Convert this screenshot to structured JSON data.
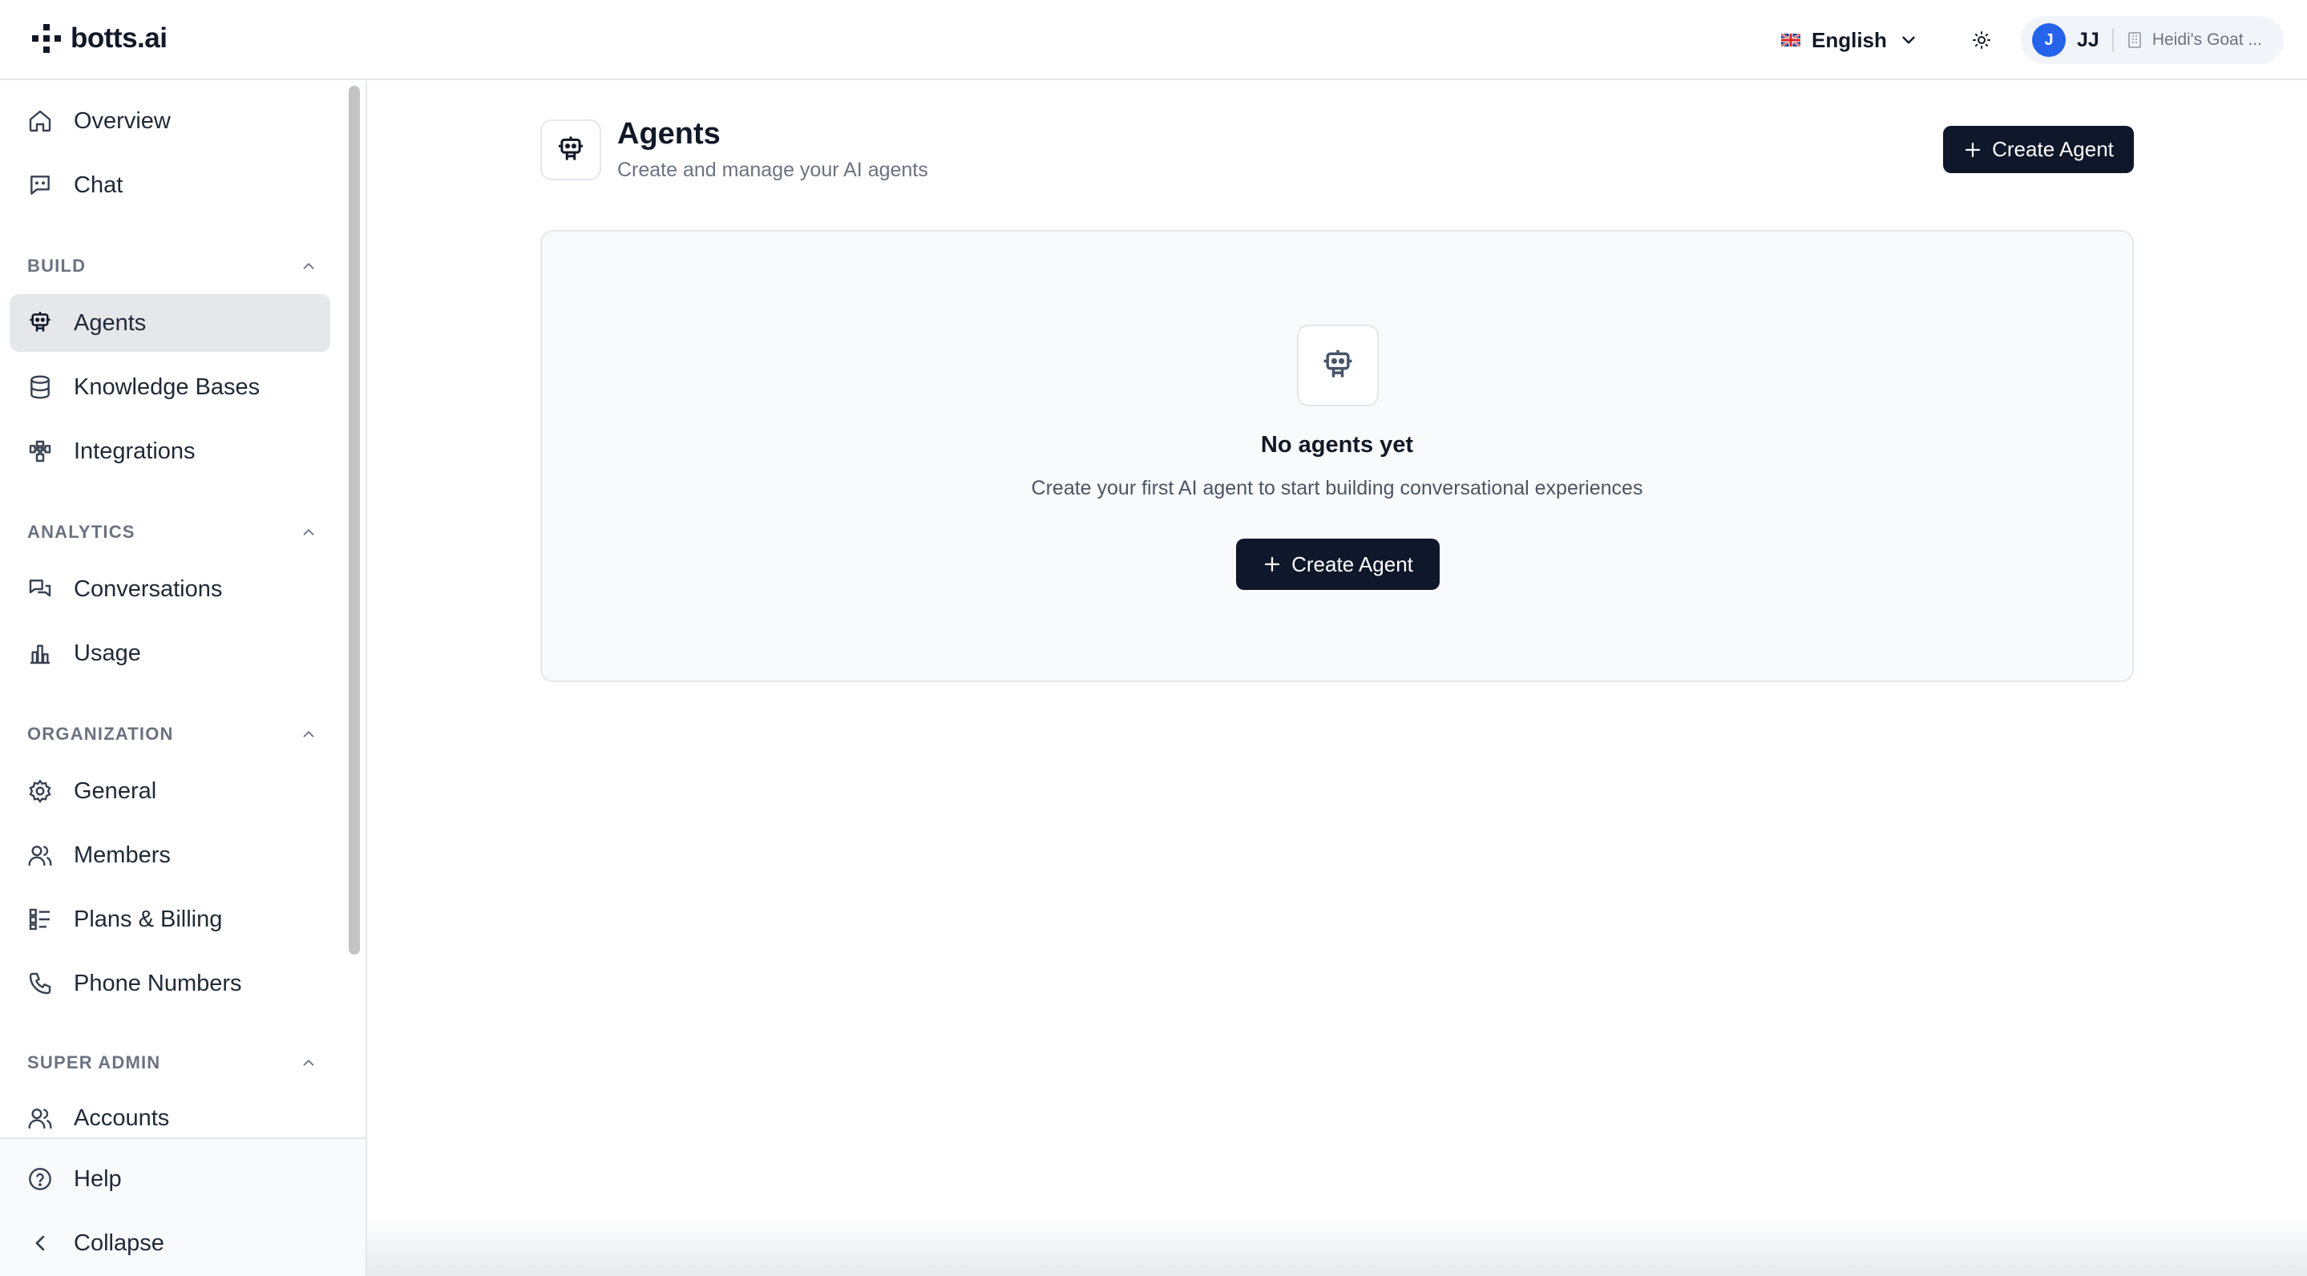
{
  "app": {
    "brand": "botts.ai"
  },
  "topbar": {
    "language": "English",
    "user_avatar": "J",
    "user_initials": "JJ",
    "organization": "Heidi's Goat ..."
  },
  "sidebar": {
    "top_items": [
      {
        "label": "Overview",
        "icon": "home-icon"
      },
      {
        "label": "Chat",
        "icon": "chat-icon"
      }
    ],
    "sections": [
      {
        "title": "BUILD",
        "items": [
          {
            "label": "Agents",
            "icon": "robot-icon",
            "active": true
          },
          {
            "label": "Knowledge Bases",
            "icon": "database-icon"
          },
          {
            "label": "Integrations",
            "icon": "puzzle-icon"
          }
        ]
      },
      {
        "title": "ANALYTICS",
        "items": [
          {
            "label": "Conversations",
            "icon": "conversations-icon"
          },
          {
            "label": "Usage",
            "icon": "bar-chart-icon"
          }
        ]
      },
      {
        "title": "ORGANIZATION",
        "items": [
          {
            "label": "General",
            "icon": "gear-icon"
          },
          {
            "label": "Members",
            "icon": "users-icon"
          },
          {
            "label": "Plans & Billing",
            "icon": "list-icon"
          },
          {
            "label": "Phone Numbers",
            "icon": "phone-icon"
          }
        ]
      },
      {
        "title": "SUPER ADMIN",
        "items": [
          {
            "label": "Accounts",
            "icon": "users-icon"
          }
        ]
      }
    ],
    "bottom_items": [
      {
        "label": "Help",
        "icon": "help-icon"
      },
      {
        "label": "Collapse",
        "icon": "chevron-left-icon"
      }
    ]
  },
  "page": {
    "title": "Agents",
    "subtitle": "Create and manage your AI agents",
    "create_button": "Create Agent"
  },
  "empty_state": {
    "title": "No agents yet",
    "description": "Create your first AI agent to start building conversational experiences",
    "button": "Create Agent"
  },
  "colors": {
    "primary_button": "#0f172a",
    "avatar": "#2563eb",
    "active_nav": "#e5e7eb"
  }
}
